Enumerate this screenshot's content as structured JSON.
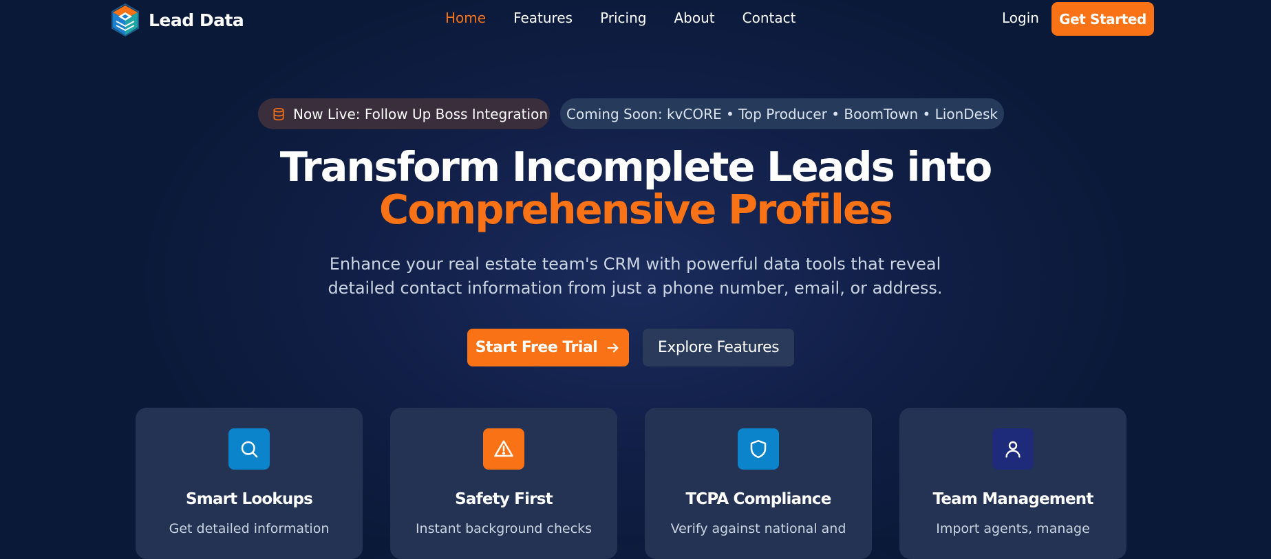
{
  "nav": {
    "brand": "Lead Data",
    "links": [
      {
        "label": "Home",
        "active": true
      },
      {
        "label": "Features",
        "active": false
      },
      {
        "label": "Pricing",
        "active": false
      },
      {
        "label": "About",
        "active": false
      },
      {
        "label": "Contact",
        "active": false
      }
    ],
    "login": "Login",
    "cta": "Get Started"
  },
  "pills": {
    "live": "Now Live: Follow Up Boss Integration",
    "soon": "Coming Soon: kvCORE • Top Producer • BoomTown • LionDesk"
  },
  "hero": {
    "headline_line1": "Transform Incomplete Leads into",
    "headline_line2": "Comprehensive Profiles",
    "subtext": "Enhance your real estate team's CRM with powerful data tools that reveal detailed contact information from just a phone number, email, or address.",
    "primary_cta": "Start Free Trial",
    "secondary_cta": "Explore Features"
  },
  "features": [
    {
      "title": "Smart Lookups",
      "desc": "Get detailed information",
      "icon": "search-icon",
      "color": "#0b84cc"
    },
    {
      "title": "Safety First",
      "desc": "Instant background checks",
      "icon": "warning-icon",
      "color": "#f97316"
    },
    {
      "title": "TCPA Compliance",
      "desc": "Verify against national and",
      "icon": "shield-icon",
      "color": "#0b84cc"
    },
    {
      "title": "Team Management",
      "desc": "Import agents, manage",
      "icon": "user-icon",
      "color": "#1e2a7a"
    }
  ],
  "colors": {
    "accent": "#f97316",
    "background": "#0b1939",
    "card": "#243354"
  }
}
